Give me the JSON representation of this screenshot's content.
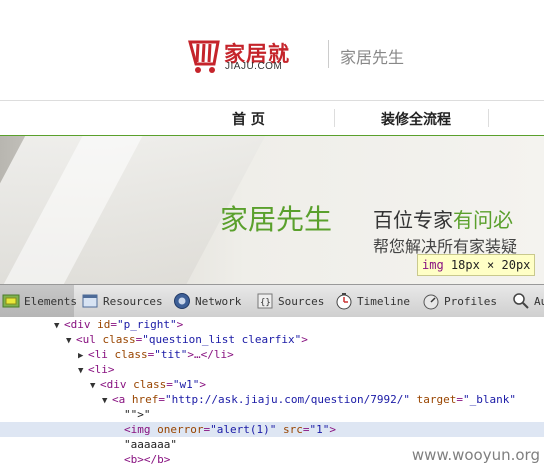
{
  "header": {
    "brand_name": "家居就",
    "brand_domain": "JIAJU.COM",
    "tagline": "家居先生",
    "brand_color": "#c5242b"
  },
  "nav": {
    "items": [
      "首 页",
      "装修全流程"
    ],
    "accent_color": "#5aa02c"
  },
  "banner": {
    "title": "家居先生",
    "subtitle_a": "百位专家",
    "subtitle_b": "有问必",
    "line2": "帮您解决所有家装疑"
  },
  "tooltip": {
    "tag": "img",
    "size": "18px × 20px"
  },
  "devtools": {
    "tabs": [
      {
        "label": "Elements",
        "icon": "elements-icon"
      },
      {
        "label": "Resources",
        "icon": "resources-icon"
      },
      {
        "label": "Network",
        "icon": "network-icon"
      },
      {
        "label": "Sources",
        "icon": "sources-icon"
      },
      {
        "label": "Timeline",
        "icon": "timeline-icon"
      },
      {
        "label": "Profiles",
        "icon": "profiles-icon"
      },
      {
        "label": "Au",
        "icon": "audits-icon"
      }
    ],
    "active_tab": "Elements"
  },
  "dom": {
    "l1_tag": "<div ",
    "l1_attr": "id",
    "l1_val": "\"p_right\"",
    "l1_end": ">",
    "l2_tag": "<ul ",
    "l2_attr": "class",
    "l2_val": "\"question_list clearfix\"",
    "l2_end": ">",
    "l3_tag": "<li ",
    "l3_attr": "class",
    "l3_val": "\"tit\"",
    "l3_end": ">…</li>",
    "l4_tag": "<li>",
    "l5_tag": "<div ",
    "l5_attr": "class",
    "l5_val": "\"w1\"",
    "l5_end": ">",
    "l6_tag": "<a ",
    "l6_attr1": "href",
    "l6_val1": "\"http://ask.jiaju.com/question/7992/\"",
    "l6_attr2": " target",
    "l6_val2": "\"_blank\"",
    "l7_text": "\"\">\"",
    "l8_tag": "<img ",
    "l8_attr1": "onerror",
    "l8_val1": "\"alert(1)\"",
    "l8_attr2": " src",
    "l8_val2": "\"1\"",
    "l8_end": ">",
    "l9_text": "\"aaaaaa\"",
    "l10_tag": "<b></b>"
  },
  "watermark": "www.wooyun.org"
}
